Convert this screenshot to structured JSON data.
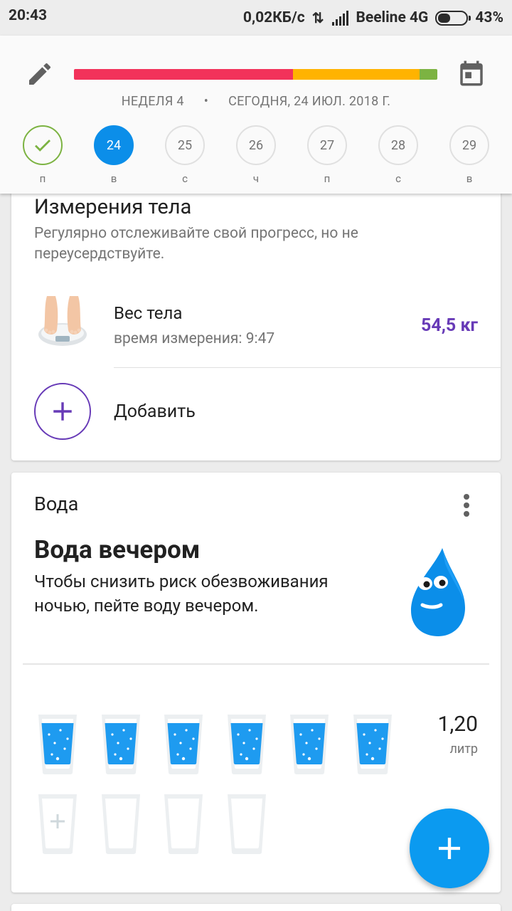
{
  "status_bar": {
    "time": "20:43",
    "speed": "0,02КБ/с",
    "carrier": "Beeline 4G",
    "battery": "43%",
    "battery_level": 0.43
  },
  "header": {
    "progress_segments": [
      {
        "color": "#f2325a",
        "fraction": 0.602
      },
      {
        "color": "#ffb300",
        "fraction": 0.35
      },
      {
        "color": "#7cb342",
        "fraction": 0.048
      }
    ],
    "week_label": "НЕДЕЛЯ 4",
    "separator": "•",
    "today_label": "СЕГОДНЯ, 24 ИЮЛ. 2018 Г.",
    "days": [
      {
        "number": "",
        "label": "п",
        "state": "done"
      },
      {
        "number": "24",
        "label": "в",
        "state": "today"
      },
      {
        "number": "25",
        "label": "с",
        "state": "future"
      },
      {
        "number": "26",
        "label": "ч",
        "state": "future"
      },
      {
        "number": "27",
        "label": "п",
        "state": "future"
      },
      {
        "number": "28",
        "label": "с",
        "state": "future"
      },
      {
        "number": "29",
        "label": "в",
        "state": "future"
      }
    ]
  },
  "body_card": {
    "title": "Измерения тела",
    "subtitle": "Регулярно отслеживайте свой прогресс, но не переусердствуйте.",
    "weight": {
      "title": "Вес тела",
      "time": "время измерения: 9:47",
      "value": "54,5 кг"
    },
    "add_label": "Добавить"
  },
  "water_card": {
    "title": "Вода",
    "tip_title": "Вода вечером",
    "tip_text": "Чтобы снизить риск обезвоживания ночью, пейте воду вечером.",
    "glasses_filled": 6,
    "glasses_total": 10,
    "amount": "1,20",
    "unit": "литр"
  },
  "colors": {
    "accent_purple": "#673ab7",
    "accent_blue": "#0b9af0",
    "done_green": "#7cb342"
  }
}
